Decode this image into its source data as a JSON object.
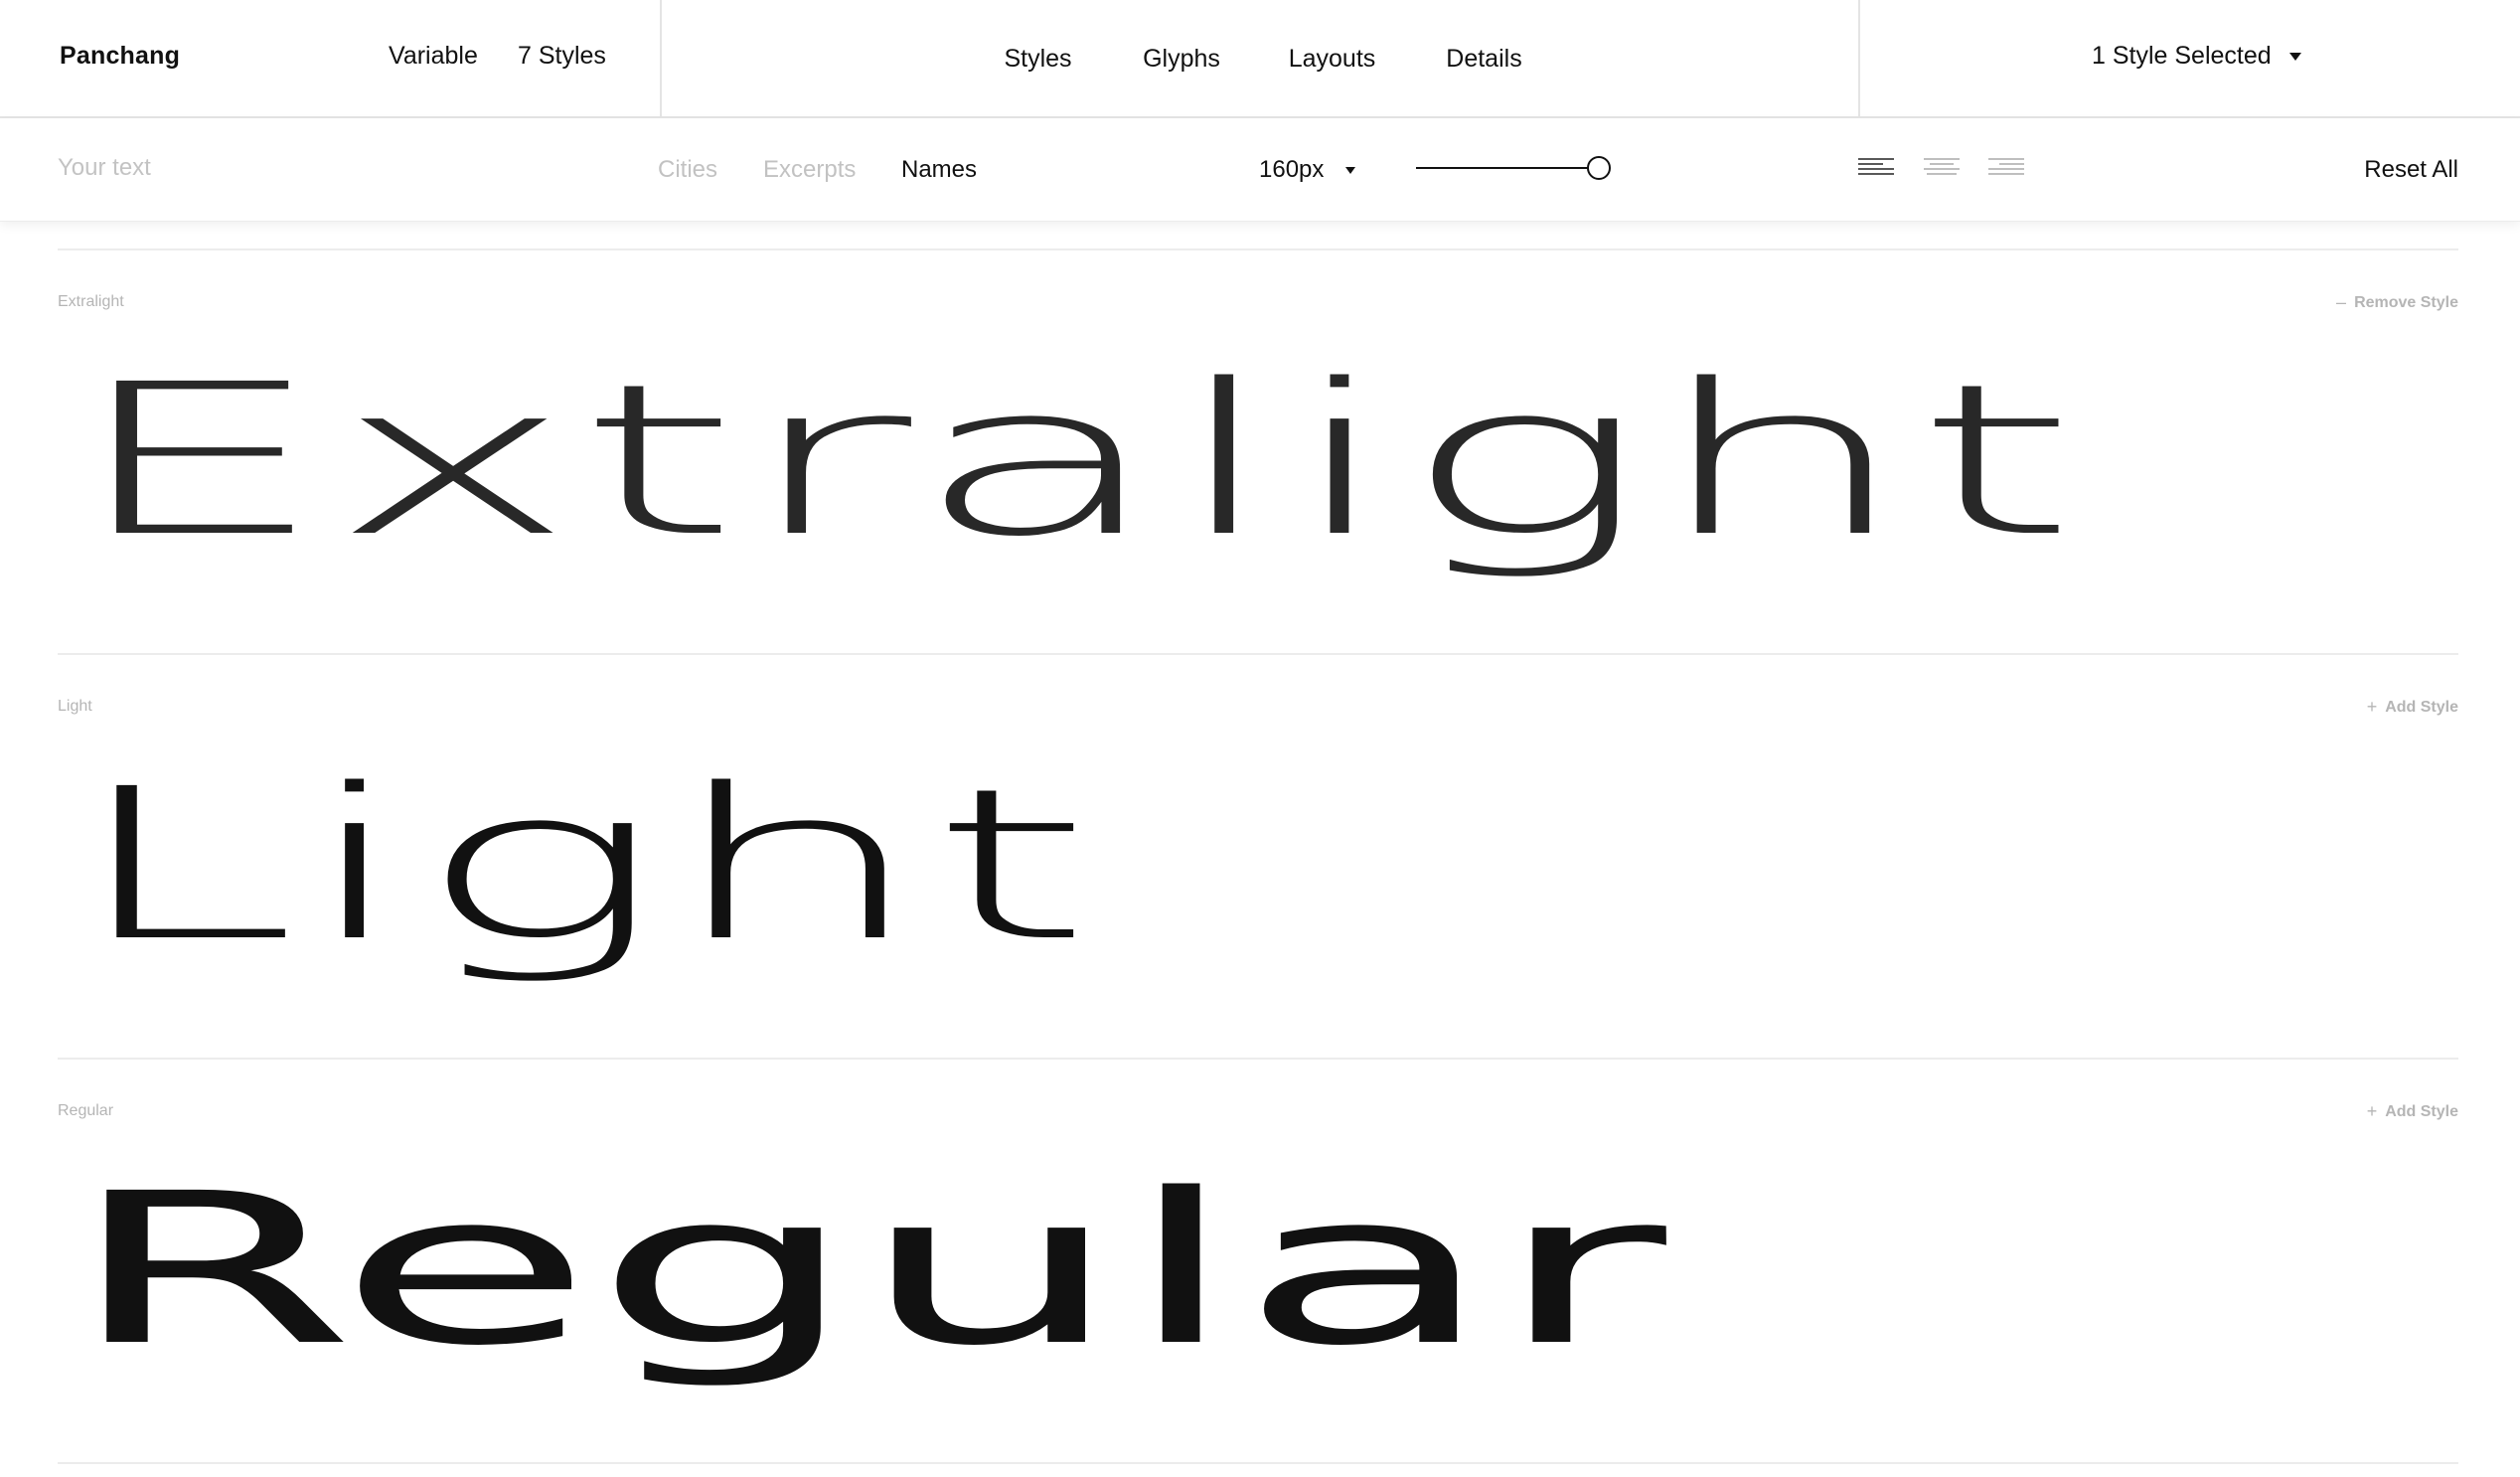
{
  "app": {
    "brand": "Panchang"
  },
  "header": {
    "variable_label": "Variable",
    "styles_count_label": "7 Styles",
    "tabs": [
      {
        "label": "Styles",
        "active": true
      },
      {
        "label": "Glyphs",
        "active": false
      },
      {
        "label": "Layouts",
        "active": false
      },
      {
        "label": "Details",
        "active": false
      }
    ],
    "style_selector": {
      "label": "1 Style Selected",
      "icon": "chevron-down-icon"
    }
  },
  "toolbar": {
    "text_input": {
      "value": "",
      "placeholder": "Your text"
    },
    "presets": [
      {
        "label": "Cities",
        "active": false
      },
      {
        "label": "Excerpts",
        "active": false
      },
      {
        "label": "Names",
        "active": true
      }
    ],
    "font_size": {
      "value": "160px",
      "icon": "chevron-down-icon"
    },
    "size_slider": {
      "value": 1.0
    },
    "alignment": {
      "options": [
        "align-left-icon",
        "align-center-icon",
        "align-right-icon"
      ],
      "selected": "align-left-icon"
    },
    "reset_label": "Reset All"
  },
  "specimens": [
    {
      "label": "Extralight",
      "sample": "Extralight",
      "action": {
        "symbol": "–",
        "label": "Remove Style"
      },
      "weight": 100
    },
    {
      "label": "Light",
      "sample": "Light",
      "action": {
        "symbol": "+",
        "label": "Add Style"
      },
      "weight": 300
    },
    {
      "label": "Regular",
      "sample": "Regular",
      "action": {
        "symbol": "+",
        "label": "Add Style"
      },
      "weight": 400
    }
  ],
  "colors": {
    "text": "#111111",
    "muted": "#b5b5b5",
    "inactive": "#c2c2c2",
    "divider": "#e4e4e4"
  }
}
